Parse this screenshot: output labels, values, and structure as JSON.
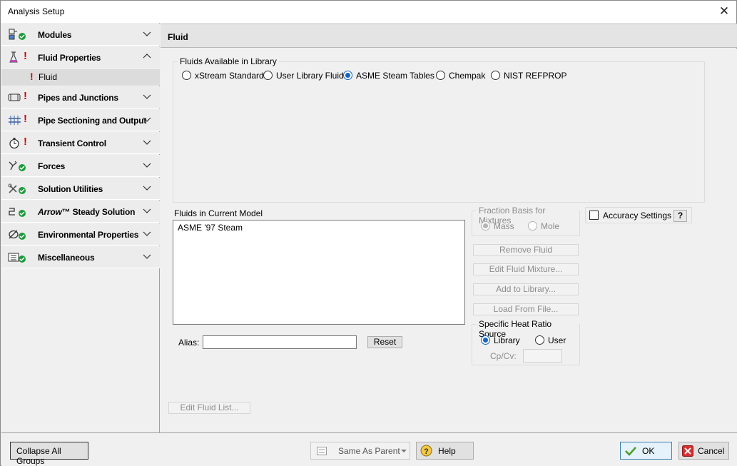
{
  "window": {
    "title": "Analysis Setup",
    "close_glyph": "✕"
  },
  "sidebar": {
    "items": [
      {
        "label": "Modules",
        "icon": "modules-icon",
        "status": "ok"
      },
      {
        "label": "Fluid Properties",
        "icon": "flask-icon",
        "status": "error",
        "expanded": true
      },
      {
        "label": "Pipes and Junctions",
        "icon": "pipe-icon",
        "status": "error"
      },
      {
        "label": "Pipe Sectioning and Output",
        "icon": "sectioning-icon",
        "status": "error"
      },
      {
        "label": "Transient Control",
        "icon": "stopwatch-icon",
        "status": "error"
      },
      {
        "label": "Forces",
        "icon": "forces-icon",
        "status": "ok"
      },
      {
        "label": "Solution Utilities",
        "icon": "tools-icon",
        "status": "ok"
      },
      {
        "label": "™ Steady Solution",
        "brand": "Arrow",
        "icon": "solution-icon",
        "status": "ok"
      },
      {
        "label": "Environmental Properties",
        "icon": "environment-icon",
        "status": "ok"
      },
      {
        "label": "Miscellaneous",
        "icon": "misc-icon",
        "status": "ok"
      }
    ],
    "subitem": {
      "label": "Fluid",
      "status": "error"
    }
  },
  "main": {
    "header": "Fluid",
    "library_group": {
      "label": "Fluids Available in Library",
      "options": [
        "xStream Standard",
        "User Library Fluid",
        "ASME Steam Tables",
        "Chempak",
        "NIST REFPROP"
      ],
      "selected": "ASME Steam Tables"
    },
    "current_model": {
      "label": "Fluids in Current Model",
      "items": [
        "ASME '97 Steam"
      ]
    },
    "fraction_basis": {
      "label": "Fraction Basis for Mixtures",
      "options": [
        "Mass",
        "Mole"
      ],
      "selected": "Mass"
    },
    "accuracy": {
      "label": "Accuracy Settings",
      "checked": false,
      "help": "?"
    },
    "buttons": {
      "remove": "Remove Fluid",
      "edit_mixture": "Edit Fluid Mixture...",
      "add_library": "Add to Library...",
      "load_file": "Load From File...",
      "reset": "Reset",
      "edit_list": "Edit Fluid List..."
    },
    "alias": {
      "label": "Alias:",
      "value": ""
    },
    "heat_ratio": {
      "label": "Specific Heat Ratio Source",
      "options": [
        "Library",
        "User"
      ],
      "selected": "Library",
      "cpcv_label": "Cp/Cv:",
      "cpcv_value": ""
    }
  },
  "footer": {
    "collapse": "Collapse All Groups",
    "same_as_parent": "Same As Parent",
    "help": "Help",
    "ok": "OK",
    "cancel": "Cancel"
  },
  "colors": {
    "error": "#d00000",
    "ok": "#1a9c3a",
    "accent": "#1565c0"
  }
}
